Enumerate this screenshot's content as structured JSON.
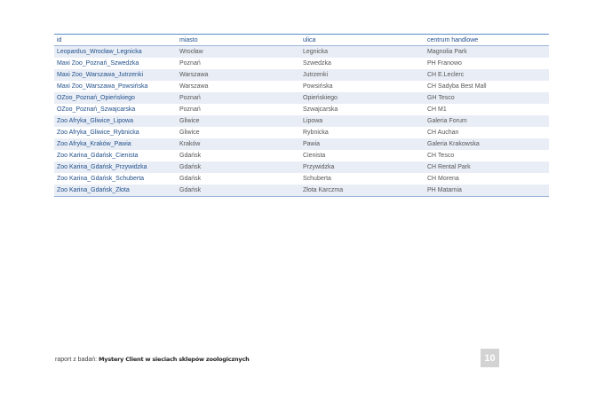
{
  "table": {
    "headers": [
      "id",
      "miasto",
      "ulica",
      "centrum handlowe"
    ],
    "rows": [
      [
        "Leopardus_Wrocław_Legnicka",
        "Wrocław",
        "Legnicka",
        "Magnolia Park"
      ],
      [
        "Maxi Zoo_Poznań_Szwedzka",
        "Poznań",
        "Szwedzka",
        "PH Franowo"
      ],
      [
        "Maxi Zoo_Warszawa_Jutrzenki",
        "Warszawa",
        "Jutrzenki",
        "CH E.Leclerc"
      ],
      [
        "Maxi Zoo_Warszawa_Powsińska",
        "Warszawa",
        "Powsińska",
        "CH Sadyba Best Mall"
      ],
      [
        "OZoo_Poznań_Opieńskiego",
        "Poznań",
        "Opieńskiego",
        "GH Tesco"
      ],
      [
        "OZoo_Poznań_Szwajcarska",
        "Poznań",
        "Szwajcarska",
        "CH M1"
      ],
      [
        "Zoo Afryka_Gliwice_Lipowa",
        "Gliwice",
        "Lipowa",
        "Galeria Forum"
      ],
      [
        "Zoo Afryka_Gliwice_Rybnicka",
        "Gliwice",
        "Rybnicka",
        "CH Auchan"
      ],
      [
        "Zoo Afryka_Kraków_Pawia",
        "Kraków",
        "Pawia",
        "Galeria Krakowska"
      ],
      [
        "Zoo Karina_Gdańsk_Cienista",
        "Gdańsk",
        "Cienista",
        "CH Tesco"
      ],
      [
        "Zoo Karina_Gdańsk_Przywidzka",
        "Gdańsk",
        "Przywidzka",
        "CH Rental Park"
      ],
      [
        "Zoo Karina_Gdańsk_Schuberta",
        "Gdańsk",
        "Schuberta",
        "CH Morena"
      ],
      [
        "Zoo Karina_Gdańsk_Złota",
        "Gdańsk",
        "Złota Karczma",
        "PH Matarnia"
      ]
    ]
  },
  "footer": {
    "prefix": "raport z badań: ",
    "title": "Mystery Client w sieciach sklepów zoologicznych",
    "page_number": "10"
  },
  "colors": {
    "header_line": "#5b8bc4",
    "id_text": "#1f4e8a",
    "row_stripe": "#e9eef6",
    "page_badge": "#d3d3d3"
  }
}
